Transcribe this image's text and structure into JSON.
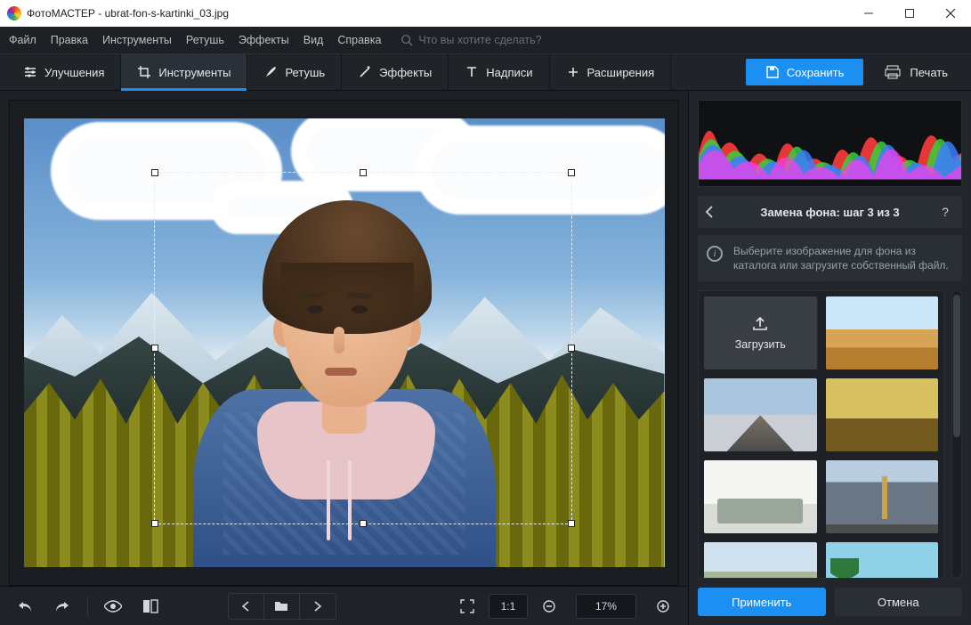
{
  "window": {
    "app_name": "ФотоМАСТЕР",
    "document": "ubrat-fon-s-kartinki_03.jpg"
  },
  "menu": {
    "file": "Файл",
    "edit": "Правка",
    "tools": "Инструменты",
    "retouch": "Ретушь",
    "effects": "Эффекты",
    "view": "Вид",
    "help": "Справка",
    "search_placeholder": "Что вы хотите сделать?"
  },
  "ribbon": {
    "enhance": "Улучшения",
    "tools": "Инструменты",
    "retouch": "Ретушь",
    "effects": "Эффекты",
    "text": "Надписи",
    "extensions": "Расширения",
    "save": "Сохранить",
    "print": "Печать"
  },
  "toolbar": {
    "one_to_one": "1:1",
    "zoom": "17%"
  },
  "panel": {
    "step_title": "Замена фона: шаг 3 из 3",
    "hint": "Выберите изображение для фона из каталога или загрузите собственный файл.",
    "upload": "Загрузить",
    "apply": "Применить",
    "cancel": "Отмена"
  }
}
